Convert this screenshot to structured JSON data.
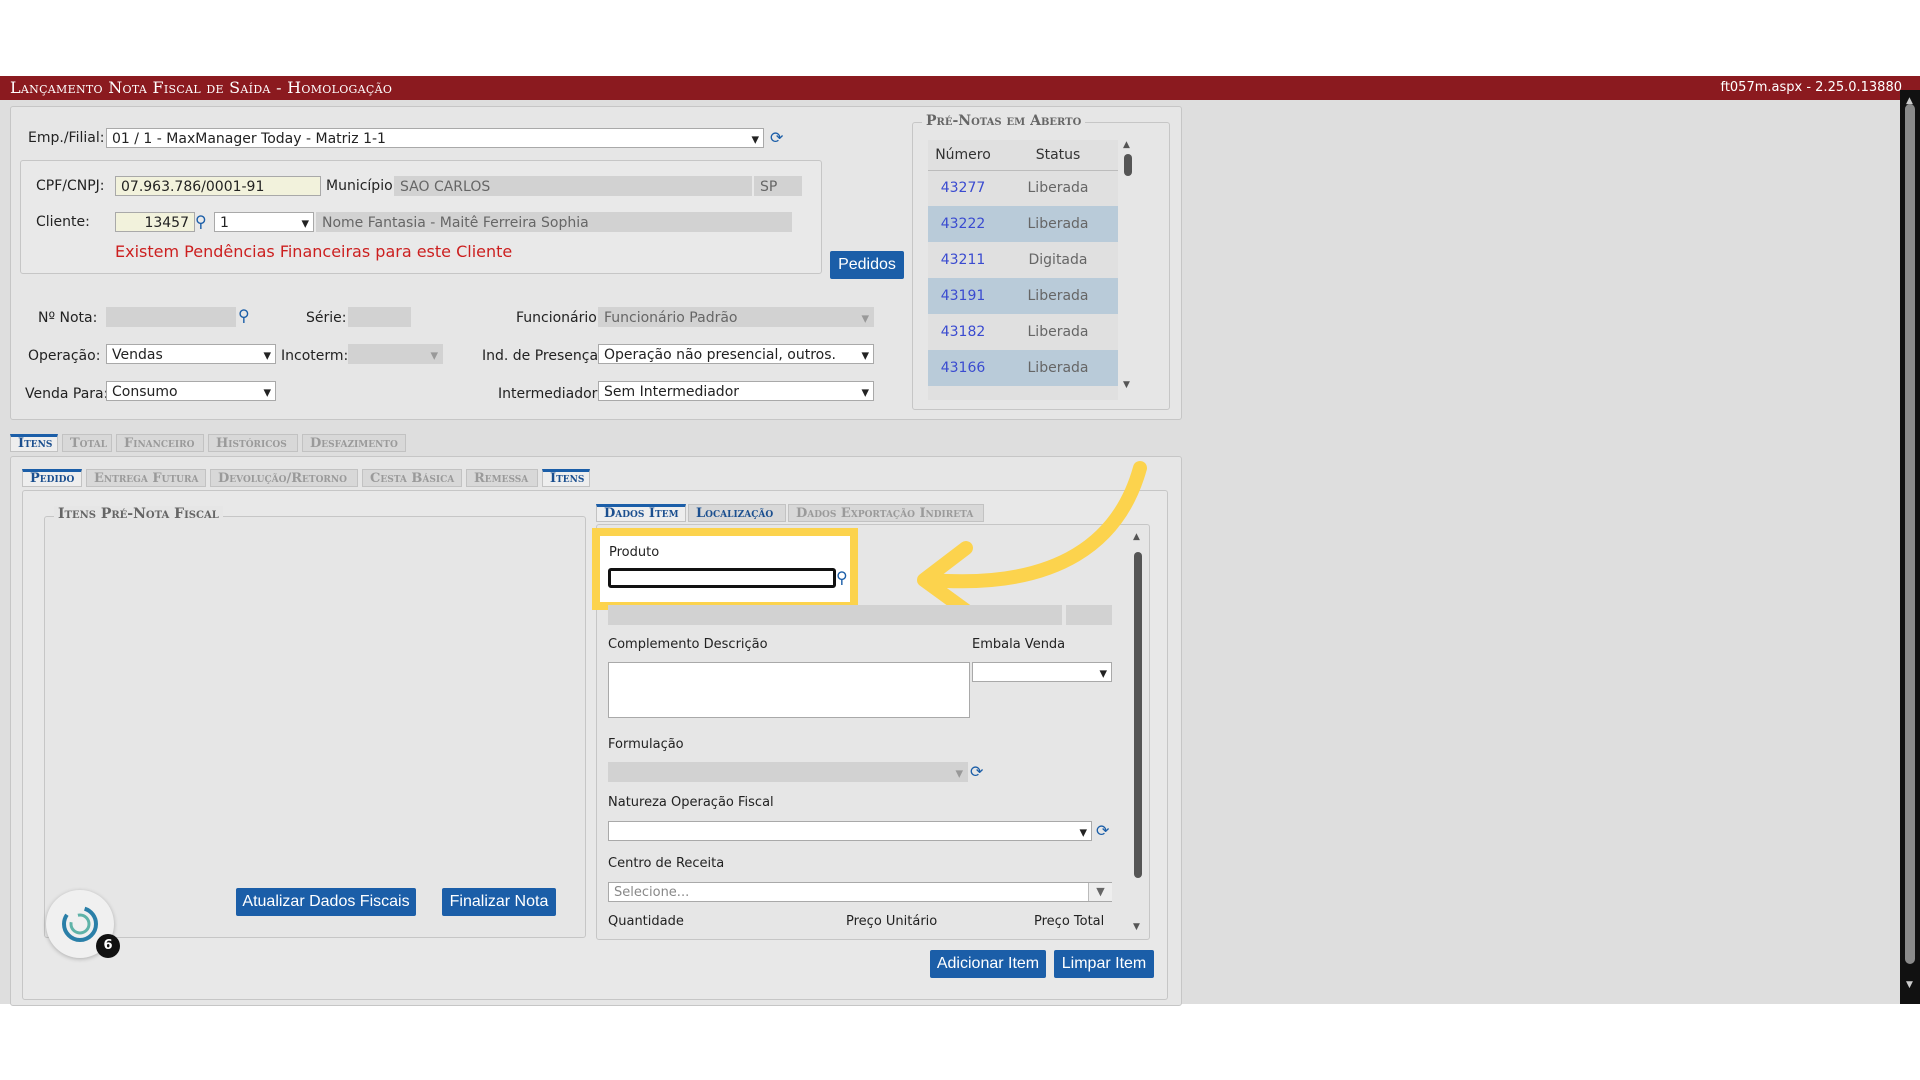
{
  "header": {
    "title": "Lançamento Nota Fiscal de Saída  - Homologação",
    "version": "ft057m.aspx - 2.25.0.13880"
  },
  "emp": {
    "label": "Emp./Filial:",
    "value": "01 / 1 - MaxManager Today - Matriz 1-1"
  },
  "cliente_box": {
    "cpf_label": "CPF/CNPJ:",
    "cpf_value": "07.963.786/0001-91",
    "municipio_label": "Município:",
    "municipio_value": "SAO CARLOS",
    "uf_value": "SP",
    "cliente_label": "Cliente:",
    "cliente_code": "13457",
    "cliente_seq": "1",
    "cliente_name": "Nome Fantasia - Maitê Ferreira Sophia",
    "warning": "Existem Pendências Financeiras para este Cliente"
  },
  "pedidos_button": "Pedidos",
  "form": {
    "nota_label": "Nº Nota:",
    "serie_label": "Série:",
    "funcionario_label": "Funcionário:",
    "funcionario_value": "Funcionário Padrão",
    "operacao_label": "Operação:",
    "operacao_value": "Vendas",
    "incoterm_label": "Incoterm:",
    "incoterm_value": "",
    "presenca_label": "Ind. de Presença:",
    "presenca_value": "Operação não presencial, outros.",
    "venda_label": "Venda Para:",
    "venda_value": "Consumo",
    "intermediador_label": "Intermediador:",
    "intermediador_value": "Sem Intermediador"
  },
  "pre_notas": {
    "title": "Pré-Notas em Aberto",
    "col_numero": "Número",
    "col_status": "Status",
    "rows": [
      {
        "numero": "43277",
        "status": "Liberada"
      },
      {
        "numero": "43222",
        "status": "Liberada"
      },
      {
        "numero": "43211",
        "status": "Digitada"
      },
      {
        "numero": "43191",
        "status": "Liberada"
      },
      {
        "numero": "43182",
        "status": "Liberada"
      },
      {
        "numero": "43166",
        "status": "Liberada"
      }
    ]
  },
  "main_tabs": [
    "Itens",
    "Total",
    "Financeiro",
    "Históricos",
    "Desfazimento"
  ],
  "sub_tabs": [
    "Pedido",
    "Entrega Futura",
    "Devolução/Retorno",
    "Cesta Básica",
    "Remessa",
    "Itens"
  ],
  "itens_panel": {
    "title": "Itens Pré-Nota Fiscal",
    "atualizar": "Atualizar Dados Fiscais",
    "finalizar": "Finalizar Nota",
    "badge": "6"
  },
  "item_tabs": [
    "Dados Item",
    "Localização",
    "Dados Exportação Indireta"
  ],
  "item_form": {
    "produto_label": "Produto",
    "complemento_label": "Complemento Descrição",
    "embala_label": "Embala Venda",
    "formulacao_label": "Formulação",
    "natureza_label": "Natureza Operação Fiscal",
    "centro_label": "Centro de Receita",
    "centro_placeholder": "Selecione...",
    "quantidade_label": "Quantidade",
    "preco_unit_label": "Preço Unitário",
    "preco_total_label": "Preço Total"
  },
  "bottom_buttons": {
    "adicionar": "Adicionar Item",
    "limpar": "Limpar Item"
  },
  "colors": {
    "title_bar": "#8b1a1f",
    "button": "#1b5ea8",
    "highlight": "#fcd34d",
    "warning": "#cc1f1f"
  }
}
